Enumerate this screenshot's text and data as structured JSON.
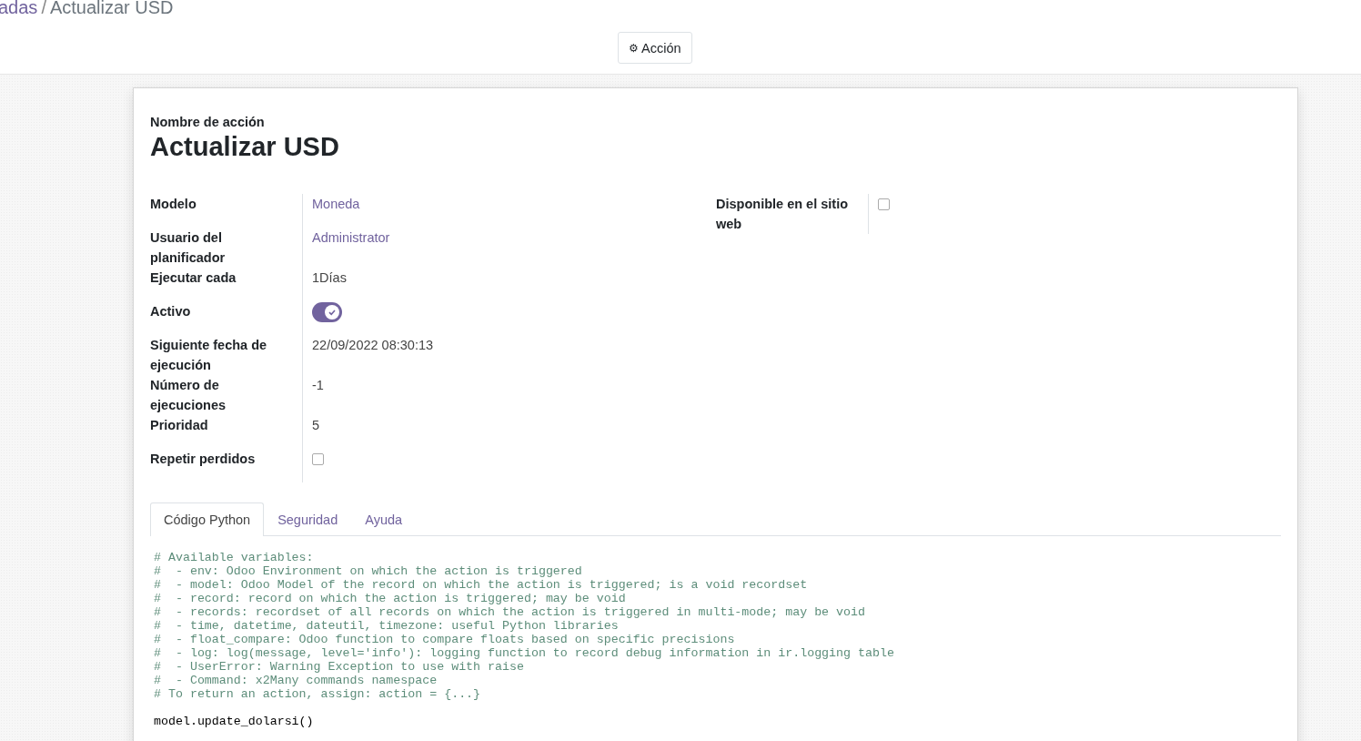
{
  "breadcrumb": {
    "parent": "adas",
    "separator": "/",
    "current": "Actualizar USD"
  },
  "action_button": {
    "icon": "⚙",
    "label": "Acción"
  },
  "form": {
    "name_label": "Nombre de acción",
    "name": "Actualizar USD",
    "left_fields": [
      {
        "label": "Modelo",
        "kind": "link",
        "value": "Moneda"
      },
      {
        "label": "Usuario del planificador",
        "kind": "link",
        "value": "Administrator"
      },
      {
        "label": "Ejecutar cada",
        "kind": "text",
        "value": "1Días"
      },
      {
        "label": "Activo",
        "kind": "toggle",
        "on": true
      },
      {
        "label": "Siguiente fecha de ejecución",
        "kind": "text",
        "value": "22/09/2022 08:30:13"
      },
      {
        "label": "Número de ejecuciones",
        "kind": "text",
        "value": "-1"
      },
      {
        "label": "Prioridad",
        "kind": "text",
        "value": "5"
      },
      {
        "label": "Repetir perdidos",
        "kind": "checkbox",
        "checked": false
      }
    ],
    "right_fields": [
      {
        "label": "Disponible en el sitio web",
        "kind": "checkbox",
        "checked": false
      }
    ],
    "tabs": [
      {
        "label": "Código Python",
        "selected": true
      },
      {
        "label": "Seguridad",
        "selected": false
      },
      {
        "label": "Ayuda",
        "selected": false
      }
    ],
    "code_comments": [
      "# Available variables:",
      "#  - env: Odoo Environment on which the action is triggered",
      "#  - model: Odoo Model of the record on which the action is triggered; is a void recordset",
      "#  - record: record on which the action is triggered; may be void",
      "#  - records: recordset of all records on which the action is triggered in multi-mode; may be void",
      "#  - time, datetime, dateutil, timezone: useful Python libraries",
      "#  - float_compare: Odoo function to compare floats based on specific precisions",
      "#  - log: log(message, level='info'): logging function to record debug information in ir.logging table",
      "#  - UserError: Warning Exception to use with raise",
      "#  - Command: x2Many commands namespace",
      "# To return an action, assign: action = {...}"
    ],
    "code": [
      "model.update_dolarsi()"
    ]
  }
}
